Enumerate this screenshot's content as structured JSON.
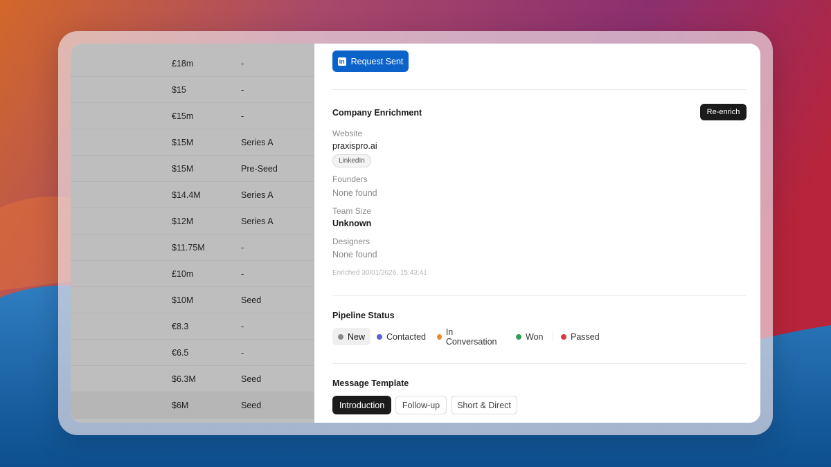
{
  "theme": {
    "linkedin_blue": "#0b63c9",
    "dark_button": "#1b1b1b",
    "status_colors": {
      "new": "#8a8a8a",
      "contacted": "#5b62d6",
      "in_conversation": "#ee8a2c",
      "won": "#2f9e5a",
      "passed": "#dc3b3b"
    }
  },
  "table": {
    "rows": [
      {
        "amount": "£18m",
        "stage": "-"
      },
      {
        "amount": "$15",
        "stage": "-"
      },
      {
        "amount": "€15m",
        "stage": "-"
      },
      {
        "amount": "$15M",
        "stage": "Series A"
      },
      {
        "amount": "$15M",
        "stage": "Pre-Seed"
      },
      {
        "amount": "$14.4M",
        "stage": "Series A"
      },
      {
        "amount": "$12M",
        "stage": "Series A"
      },
      {
        "amount": "$11.75M",
        "stage": "-"
      },
      {
        "amount": "£10m",
        "stage": "-"
      },
      {
        "amount": "$10M",
        "stage": "Seed"
      },
      {
        "amount": "€8.3",
        "stage": "-"
      },
      {
        "amount": "€6.5",
        "stage": "-"
      },
      {
        "amount": "$6.3M",
        "stage": "Seed"
      },
      {
        "amount": "$6M",
        "stage": "Seed"
      }
    ]
  },
  "panel": {
    "linkedin_button": {
      "icon": "linkedin-icon",
      "icon_glyph": "in",
      "label": "Request Sent"
    },
    "enrichment": {
      "title": "Company Enrichment",
      "reenrich_label": "Re-enrich",
      "website_label": "Website",
      "website_value": "praxispro.ai",
      "linkedin_chip": "LinkedIn",
      "founders_label": "Founders",
      "founders_value": "None found",
      "team_size_label": "Team Size",
      "team_size_value": "Unknown",
      "designers_label": "Designers",
      "designers_value": "None found",
      "enriched_note": "Enriched 30/01/2026, 15:43:41"
    },
    "pipeline": {
      "title": "Pipeline Status",
      "statuses": [
        {
          "label": "New",
          "active": true
        },
        {
          "label": "Contacted",
          "active": false
        },
        {
          "label": "In Conversation",
          "active": false
        },
        {
          "label": "Won",
          "active": false
        },
        {
          "label": "Passed",
          "active": false
        }
      ]
    },
    "templates": {
      "title": "Message Template",
      "options": [
        {
          "label": "Introduction",
          "active": true
        },
        {
          "label": "Follow-up",
          "active": false
        },
        {
          "label": "Short & Direct",
          "active": false
        }
      ]
    }
  }
}
